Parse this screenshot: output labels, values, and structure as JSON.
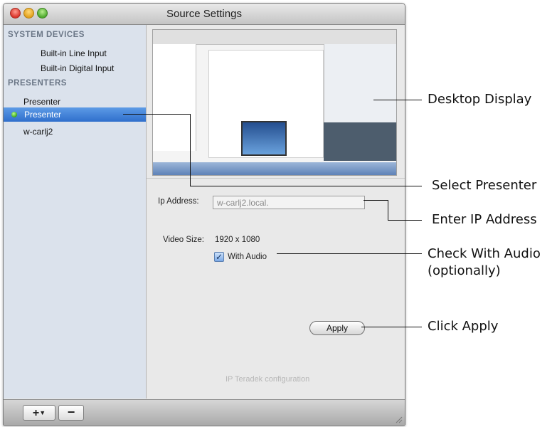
{
  "window": {
    "title": "Source Settings"
  },
  "sidebar": {
    "groups": [
      {
        "header": "SYSTEM DEVICES",
        "items": [
          "Built-in Line Input",
          "Built-in Digital Input"
        ]
      },
      {
        "header": "PRESENTERS",
        "items": [
          "Presenter",
          "Presenter",
          "w-carlj2"
        ]
      }
    ],
    "selected_item": "Presenter",
    "selected_status_color": "#3aa61c"
  },
  "main": {
    "ip_address_label": "Ip Address:",
    "ip_address_value": "w-carlj2.local.",
    "video_size_label": "Video Size:",
    "video_size_value": "1920 x 1080",
    "with_audio_label": "With Audio",
    "with_audio_checked": true,
    "apply_label": "Apply",
    "footer_text": "IP Teradek configuration"
  },
  "bottom_bar": {
    "add_label": "+",
    "remove_label": "−"
  },
  "callouts": {
    "desktop_display": "Desktop Display",
    "select_presenter": "Select Presenter",
    "enter_ip": "Enter IP Address",
    "check_audio_line1": "Check With Audio",
    "check_audio_line2": "(optionally)",
    "click_apply": "Click Apply"
  }
}
